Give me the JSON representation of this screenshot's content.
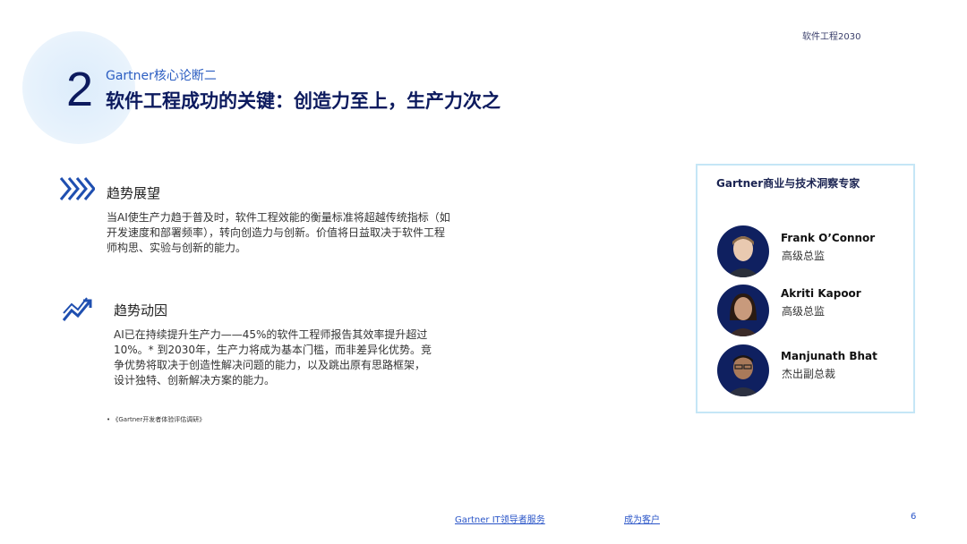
{
  "header": {
    "doc_label": "软件工程2030"
  },
  "section": {
    "number": "2",
    "subtitle": "Gartner核心论断二",
    "title": "软件工程成功的关键：创造力至上，生产力次之"
  },
  "blocks": [
    {
      "icon": "chevrons-right-icon",
      "title": "趋势展望",
      "lines": [
        "当AI使生产力趋于普及时，软件工程效能的衡量标准将超越传统指标（如",
        "开发速度和部署频率），转向创造力与创新。价值将日益取决于软件工程",
        "师构思、实验与创新的能力。"
      ]
    },
    {
      "icon": "trend-up-icon",
      "title": "趋势动因",
      "lines": [
        "AI已在持续提升生产力——45%的软件工程师报告其效率提升超过",
        "10%。* 到2030年，生产力将成为基本门槛，而非差异化优势。竞",
        "争优势将取决于创造性解决问题的能力，以及跳出原有思路框架，",
        "设计独特、创新解决方案的能力。"
      ]
    }
  ],
  "footnote": "• 《Gartner开发者体验评估调研》",
  "experts": {
    "title": "Gartner商业与技术洞察专家",
    "people": [
      {
        "name": "Frank O’Connor",
        "role": "高级总监"
      },
      {
        "name": "Akriti Kapoor",
        "role": "高级总监"
      },
      {
        "name": "Manjunath Bhat",
        "role": "杰出副总裁"
      }
    ]
  },
  "footer": {
    "link1": "Gartner IT领导者服务",
    "link2": "成为客户",
    "page": "6"
  },
  "colors": {
    "navy": "#0c1a5e",
    "accent_blue": "#2c5ec2",
    "box_border": "#c5e6f6"
  }
}
